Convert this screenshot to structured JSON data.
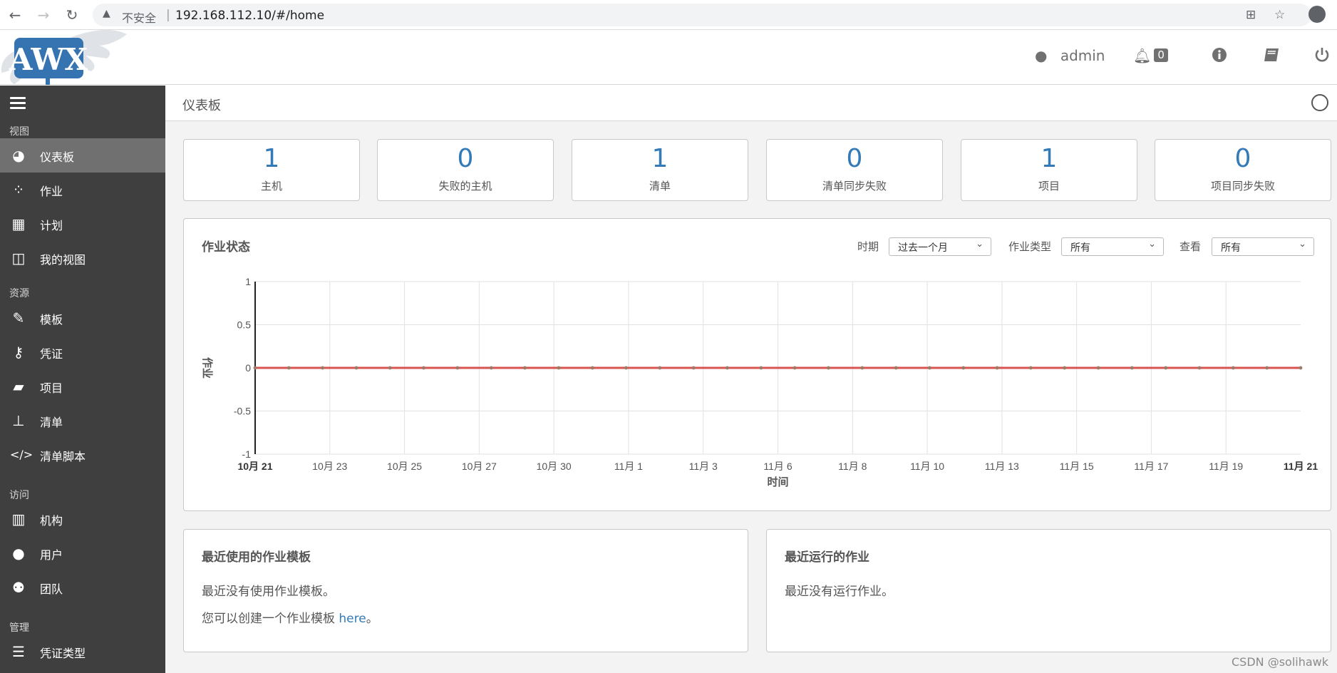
{
  "browser": {
    "security_label": "不安全",
    "separator": "|",
    "url": "192.168.112.10/#/home"
  },
  "header": {
    "user": "admin",
    "notification_count": "0"
  },
  "sidebar": {
    "sections": [
      "视图",
      "资源",
      "访问",
      "管理"
    ],
    "items": [
      {
        "label": "仪表板",
        "icon": "dashboard-icon"
      },
      {
        "label": "作业",
        "icon": "spinner-icon"
      },
      {
        "label": "计划",
        "icon": "calendar-icon"
      },
      {
        "label": "我的视图",
        "icon": "columns-icon"
      },
      {
        "label": "模板",
        "icon": "edit-icon"
      },
      {
        "label": "凭证",
        "icon": "key-icon"
      },
      {
        "label": "项目",
        "icon": "folder-icon"
      },
      {
        "label": "清单",
        "icon": "sitemap-icon"
      },
      {
        "label": "清单脚本",
        "icon": "code-icon"
      },
      {
        "label": "机构",
        "icon": "building-icon"
      },
      {
        "label": "用户",
        "icon": "user-icon"
      },
      {
        "label": "团队",
        "icon": "users-icon"
      },
      {
        "label": "凭证类型",
        "icon": "list-icon"
      }
    ]
  },
  "page": {
    "title": "仪表板"
  },
  "counts": [
    {
      "value": "1",
      "label": "主机"
    },
    {
      "value": "0",
      "label": "失败的主机"
    },
    {
      "value": "1",
      "label": "清单"
    },
    {
      "value": "0",
      "label": "清单同步失败"
    },
    {
      "value": "1",
      "label": "项目"
    },
    {
      "value": "0",
      "label": "项目同步失败"
    }
  ],
  "job_status": {
    "title": "作业状态",
    "period_label": "时期",
    "period_value": "过去一个月",
    "type_label": "作业类型",
    "type_value": "所有",
    "view_label": "查看",
    "view_value": "所有"
  },
  "chart_data": {
    "type": "line",
    "xlabel": "时间",
    "ylabel": "作业",
    "ylim": [
      -1,
      1
    ],
    "yticks": [
      "1",
      "0.5",
      "0",
      "-0.5",
      "-1"
    ],
    "xticks": [
      "10月 21",
      "10月 23",
      "10月 25",
      "10月 27",
      "10月 30",
      "11月 1",
      "11月 3",
      "11月 6",
      "11月 8",
      "11月 10",
      "11月 13",
      "11月 15",
      "11月 17",
      "11月 19",
      "11月 21"
    ],
    "grid": true,
    "series": [
      {
        "color": "#d9534f",
        "values": [
          0,
          0,
          0,
          0,
          0,
          0,
          0,
          0,
          0,
          0,
          0,
          0,
          0,
          0,
          0,
          0,
          0,
          0,
          0,
          0,
          0,
          0,
          0,
          0,
          0,
          0,
          0,
          0,
          0,
          0,
          0,
          0
        ]
      }
    ]
  },
  "recent_templates": {
    "title": "最近使用的作业模板",
    "empty": "最近没有使用作业模板。",
    "create_prefix": "您可以创建一个作业模板 ",
    "create_link": "here",
    "create_suffix": "。"
  },
  "recent_jobs": {
    "title": "最近运行的作业",
    "empty": "最近没有运行作业。"
  },
  "watermark": "CSDN @solihawk",
  "colors": {
    "sidebar": "#3f3f3f",
    "accent": "#337ab7",
    "line": "#d9534f"
  }
}
